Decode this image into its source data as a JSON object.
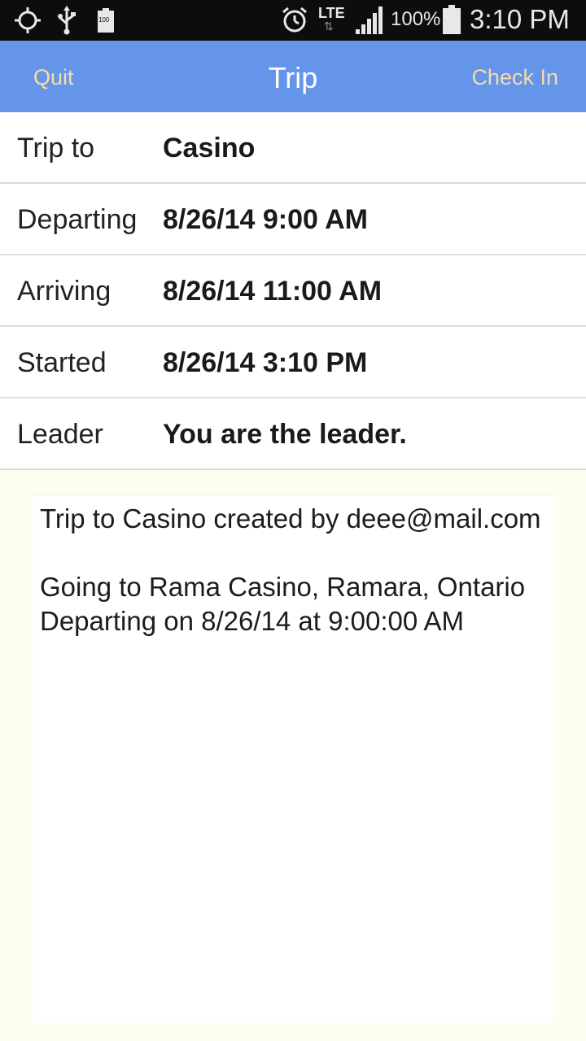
{
  "status_bar": {
    "network": "LTE",
    "battery_percent": "100%",
    "battery_icon_text": "100",
    "time": "3:10 PM",
    "icons": [
      "gps-icon",
      "usb-icon",
      "battery-small-icon",
      "alarm-icon",
      "lte-icon",
      "signal-icon",
      "battery-icon"
    ]
  },
  "header": {
    "left_button": "Quit",
    "title": "Trip",
    "right_button": "Check In"
  },
  "details": {
    "rows": [
      {
        "label": "Trip to",
        "value": "Casino"
      },
      {
        "label": "Departing",
        "value": "8/26/14 9:00 AM"
      },
      {
        "label": "Arriving",
        "value": "8/26/14 11:00 AM"
      },
      {
        "label": "Started",
        "value": "8/26/14 3:10 PM"
      },
      {
        "label": "Leader",
        "value": "You are the leader."
      }
    ]
  },
  "notes": {
    "text": "Trip to Casino created by deee@mail.com\n\nGoing to Rama Casino, Ramara, Ontario\nDeparting on 8/26/14 at 9:00:00 AM"
  },
  "colors": {
    "header_bg": "#6495ea",
    "header_button_text": "#f6dca6",
    "notes_bg": "#fefeee"
  }
}
